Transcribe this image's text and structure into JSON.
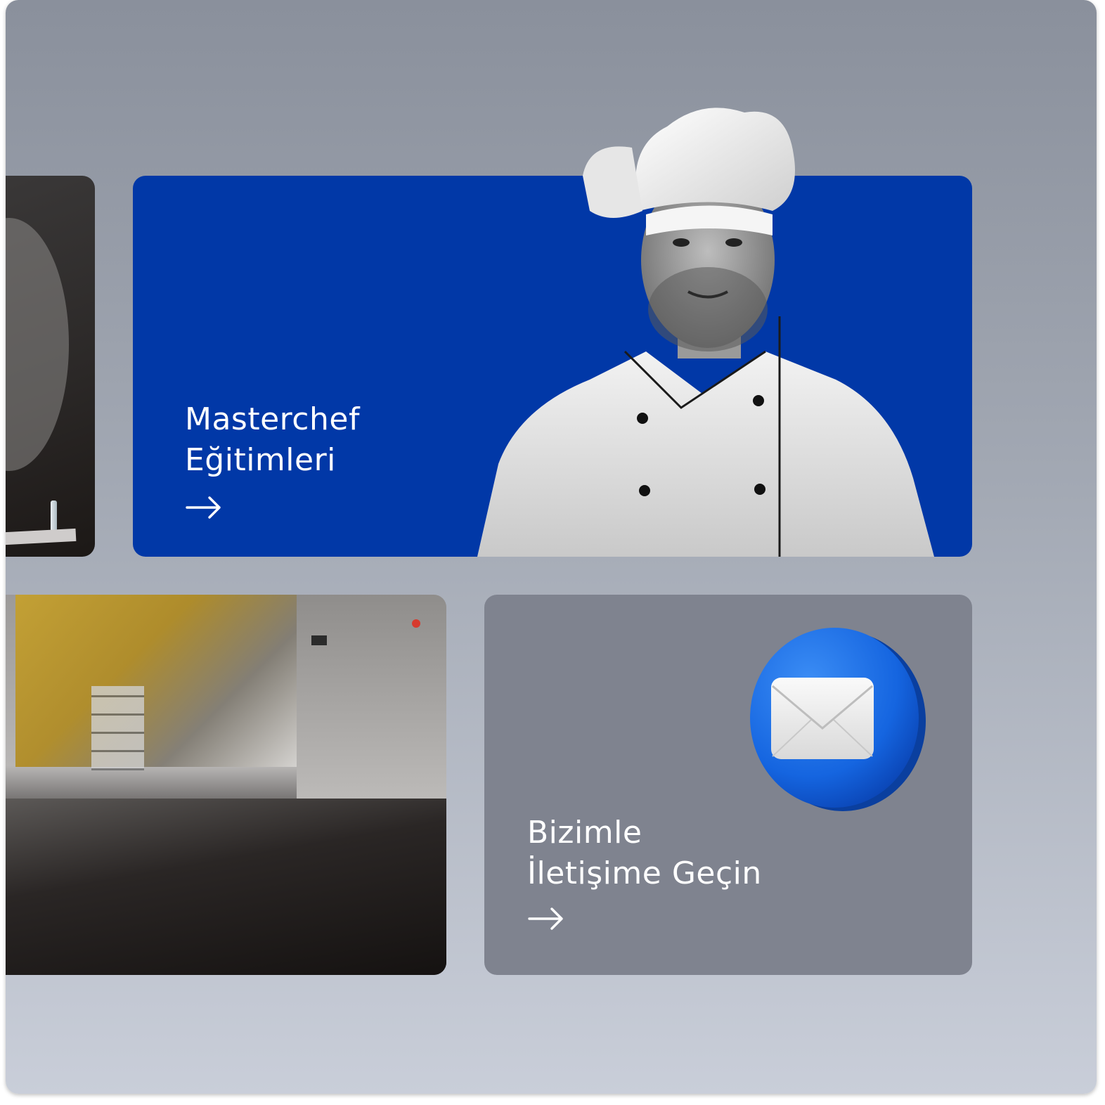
{
  "cards": {
    "masterchef": {
      "title_line1": "Masterchef",
      "title_line2": "Eğitimleri",
      "arrow_icon": "arrow-right-icon",
      "background": "#0138a7"
    },
    "contact": {
      "title_line1": "Bizimle",
      "title_line2": "İletişime Geçin",
      "arrow_icon": "arrow-right-icon",
      "icon": "mail-icon",
      "background": "#7f838f"
    }
  },
  "colors": {
    "accent": "#0138a7",
    "coin_blue": "#1a6fe0",
    "text": "#ffffff"
  }
}
